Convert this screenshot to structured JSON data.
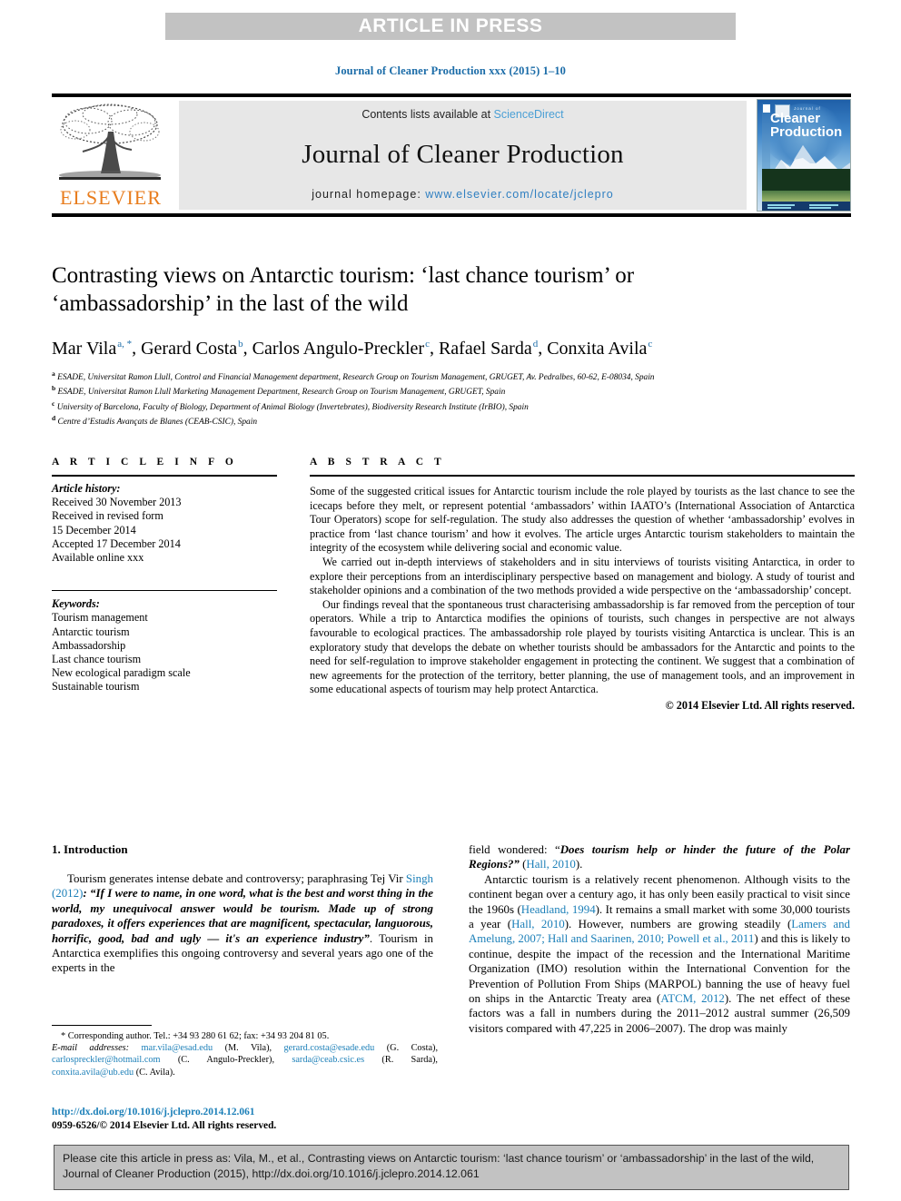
{
  "banner": {
    "text": "ARTICLE IN PRESS"
  },
  "running_head": "Journal of Cleaner Production xxx (2015) 1–10",
  "masthead": {
    "contents_prefix": "Contents lists available at ",
    "sciencedirect": "ScienceDirect",
    "journal_name": "Journal of Cleaner Production",
    "homepage_prefix": "journal homepage: ",
    "homepage_url": "www.elsevier.com/locate/jclepro",
    "publisher": "ELSEVIER",
    "cover": {
      "small_title": "Journal of",
      "main_title": "Cleaner Production"
    }
  },
  "article": {
    "title": "Contrasting views on Antarctic tourism: ‘last chance tourism’ or ‘ambassadorship’ in the last of the wild",
    "authors": [
      {
        "name": "Mar Vila",
        "marks": "a, *"
      },
      {
        "name": "Gerard Costa",
        "marks": "b"
      },
      {
        "name": "Carlos Angulo-Preckler",
        "marks": "c"
      },
      {
        "name": "Rafael Sarda",
        "marks": "d"
      },
      {
        "name": "Conxita Avila",
        "marks": "c"
      }
    ],
    "affiliations": [
      {
        "mark": "a",
        "text": "ESADE, Universitat Ramon Llull, Control and Financial Management department, Research Group on Tourism Management, GRUGET, Av. Pedralbes, 60-62, E-08034, Spain"
      },
      {
        "mark": "b",
        "text": "ESADE, Universitat Ramon Llull Marketing Management Department, Research Group on Tourism Management, GRUGET, Spain"
      },
      {
        "mark": "c",
        "text": "University of Barcelona, Faculty of Biology, Department of Animal Biology (Invertebrates), Biodiversity Research Institute (IrBIO), Spain"
      },
      {
        "mark": "d",
        "text": "Centre d’Estudis Avançats de Blanes (CEAB-CSIC), Spain"
      }
    ]
  },
  "info": {
    "heading": "A R T I C L E   I N F O",
    "history_label": "Article history:",
    "history": [
      "Received 30 November 2013",
      "Received in revised form",
      "15 December 2014",
      "Accepted 17 December 2014",
      "Available online xxx"
    ],
    "keywords_label": "Keywords:",
    "keywords": [
      "Tourism management",
      "Antarctic tourism",
      "Ambassadorship",
      "Last chance tourism",
      "New ecological paradigm scale",
      "Sustainable tourism"
    ]
  },
  "abstract": {
    "heading": "A B S T R A C T",
    "paragraphs": [
      "Some of the suggested critical issues for Antarctic tourism include the role played by tourists as the last chance to see the icecaps before they melt, or represent potential ‘ambassadors’ within IAATO’s (International Association of Antarctica Tour Operators) scope for self-regulation. The study also addresses the question of whether ‘ambassadorship’ evolves in practice from ‘last chance tourism’ and how it evolves. The article urges Antarctic tourism stakeholders to maintain the integrity of the ecosystem while delivering social and economic value.",
      "We carried out in-depth interviews of stakeholders and in situ interviews of tourists visiting Antarctica, in order to explore their perceptions from an interdisciplinary perspective based on management and biology. A study of tourist and stakeholder opinions and a combination of the two methods provided a wide perspective on the ‘ambassadorship’ concept.",
      "Our findings reveal that the spontaneous trust characterising ambassadorship is far removed from the perception of tour operators. While a trip to Antarctica modifies the opinions of tourists, such changes in perspective are not always favourable to ecological practices. The ambassadorship role played by tourists visiting Antarctica is unclear. This is an exploratory study that develops the debate on whether tourists should be ambassadors for the Antarctic and points to the need for self-regulation to improve stakeholder engagement in protecting the continent. We suggest that a combination of new agreements for the protection of the territory, better planning, the use of management tools, and an improvement in some educational aspects of tourism may help protect Antarctica."
    ],
    "copyright": "© 2014 Elsevier Ltd. All rights reserved."
  },
  "body": {
    "section_title": "1. Introduction",
    "left_paragraph_lead": "Tourism generates intense debate and controversy; paraphrasing Tej Vir ",
    "left_cite_1": "Singh (2012)",
    "left_quote": ": “If I were to name, in one word, what is the best and worst thing in the world, my unequivocal answer would be tourism. Made up of strong paradoxes, it offers experiences that are magnificent, spectacular, languorous, horrific, good, bad and ugly — it's an experience industry”",
    "left_tail": ". Tourism in Antarctica exemplifies this ongoing controversy and several years ago one of the experts in the ",
    "right_continuation_lead": "field wondered: “",
    "right_quote": "Does tourism help or hinder the future of the Polar Regions?”",
    "right_cite_hall": "Hall, 2010",
    "right_p2_a": "Antarctic tourism is a relatively recent phenomenon. Although visits to the continent began over a century ago, it has only been easily practical to visit since the 1960s (",
    "right_cite_headland": "Headland, 1994",
    "right_p2_b": "). It remains a small market with some 30,000 tourists a year (",
    "right_cite_hall2": "Hall, 2010",
    "right_p2_c": "). However, numbers are growing steadily (",
    "right_cite_lamers": "Lamers and Amelung, 2007; Hall and Saarinen, 2010; Powell et al., 2011",
    "right_p2_d": ") and this is likely to continue, despite the impact of the recession and the International Maritime Organization (IMO) resolution within the International Convention for the Prevention of Pollution From Ships (MARPOL) banning the use of heavy fuel on ships in the Antarctic Treaty area (",
    "right_cite_atcm": "ATCM, 2012",
    "right_p2_e": "). The net effect of these factors was a fall in numbers during the 2011–2012 austral summer (26,509 visitors compared with 47,225 in 2006–2007). The drop was mainly"
  },
  "footnote": {
    "corresponding": "* Corresponding author. Tel.: +34 93 280 61 62; fax: +34 93 204 81 05.",
    "email_label": "E-mail addresses:",
    "emails": [
      {
        "address": "mar.vila@esad.edu",
        "person": "(M. Vila)"
      },
      {
        "address": "gerard.costa@esade.edu",
        "person": "(G. Costa)"
      },
      {
        "address": "carlospreckler@hotmail.com",
        "person": "(C. Angulo-Preckler)"
      },
      {
        "address": "sarda@ceab.csic.es",
        "person": "(R. Sarda)"
      },
      {
        "address": "conxita.avila@ub.edu",
        "person": "(C. Avila)"
      }
    ],
    "doi": "http://dx.doi.org/10.1016/j.jclepro.2014.12.061",
    "issn": "0959-6526/© 2014 Elsevier Ltd. All rights reserved."
  },
  "cite_box": {
    "text": "Please cite this article in press as: Vila, M., et al., Contrasting views on Antarctic tourism: ‘last chance tourism’ or ‘ambassadorship’ in the last of the wild, Journal of Cleaner Production (2015), http://dx.doi.org/10.1016/j.jclepro.2014.12.061"
  },
  "colors": {
    "link": "#1b7fb8",
    "banner_bg": "#c2c2c2",
    "elsevier_orange": "#e87d1e"
  }
}
